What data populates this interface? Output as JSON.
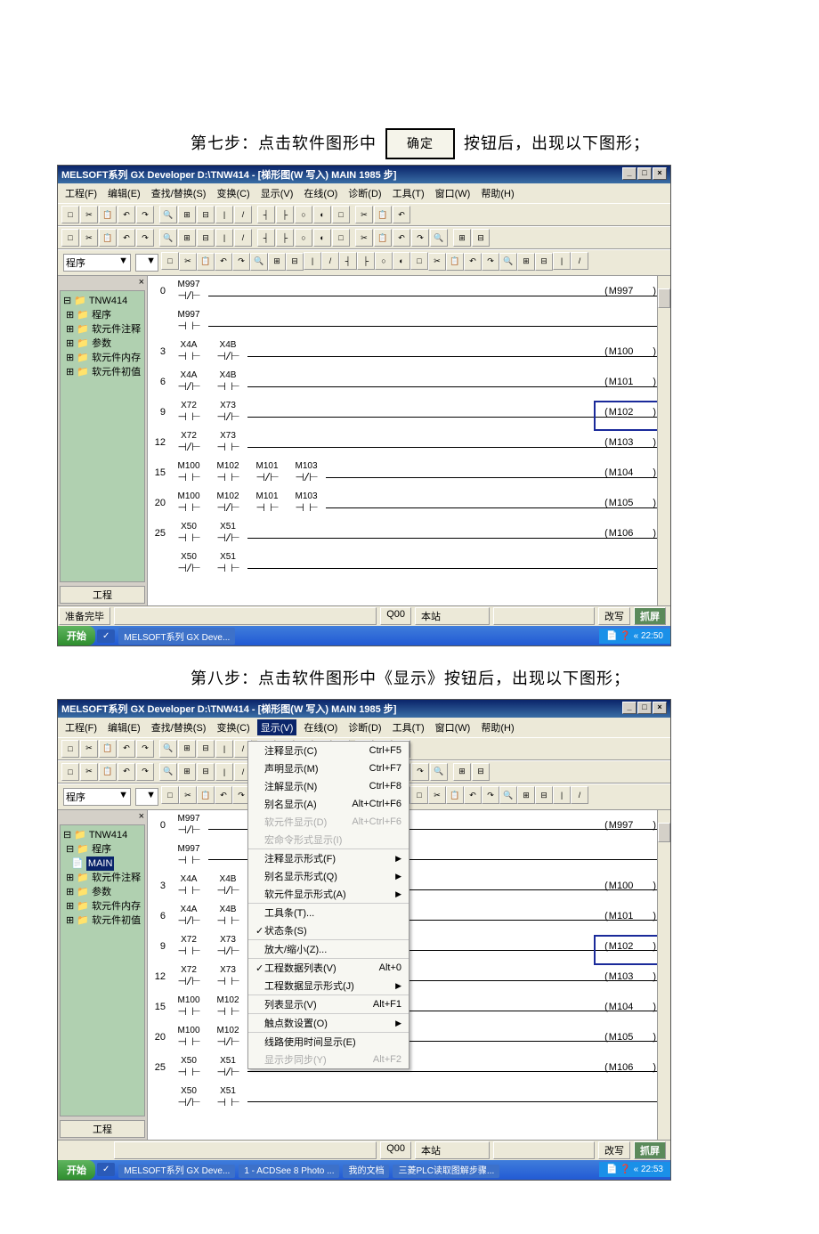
{
  "step7": {
    "pre": "第七步：点击软件图形中",
    "btn": "确定",
    "post": "按钮后，出现以下图形；"
  },
  "step8": "第八步：点击软件图形中《显示》按钮后，出现以下图形；",
  "title": "MELSOFT系列 GX Developer D:\\TNW414 - [梯形图(W 写入)    MAIN    1985 步]",
  "menu": [
    "工程(F)",
    "编辑(E)",
    "查找/替换(S)",
    "变换(C)",
    "显示(V)",
    "在线(O)",
    "诊断(D)",
    "工具(T)",
    "窗口(W)",
    "帮助(H)"
  ],
  "combo": "程序",
  "tree": {
    "root": "TNW414",
    "items": [
      "程序",
      "软元件注释",
      "参数",
      "软元件内存",
      "软元件初值"
    ],
    "main": "MAIN"
  },
  "tab": "工程",
  "ladder": [
    {
      "n": 0,
      "c": [
        {
          "l": "M997",
          "t": "nc"
        }
      ],
      "o": "M997"
    },
    {
      "n": null,
      "c": [
        {
          "l": "M997",
          "t": "no"
        }
      ],
      "o": null
    },
    {
      "n": 3,
      "c": [
        {
          "l": "X4A",
          "t": "no"
        },
        {
          "l": "X4B",
          "t": "nc"
        }
      ],
      "o": "M100"
    },
    {
      "n": 6,
      "c": [
        {
          "l": "X4A",
          "t": "nc"
        },
        {
          "l": "X4B",
          "t": "no"
        }
      ],
      "o": "M101"
    },
    {
      "n": 9,
      "c": [
        {
          "l": "X72",
          "t": "no"
        },
        {
          "l": "X73",
          "t": "nc"
        }
      ],
      "o": "M102",
      "hi": true
    },
    {
      "n": 12,
      "c": [
        {
          "l": "X72",
          "t": "nc"
        },
        {
          "l": "X73",
          "t": "no"
        }
      ],
      "o": "M103"
    },
    {
      "n": 15,
      "c": [
        {
          "l": "M100",
          "t": "no"
        },
        {
          "l": "M102",
          "t": "no"
        },
        {
          "l": "M101",
          "t": "nc"
        },
        {
          "l": "M103",
          "t": "nc"
        }
      ],
      "o": "M104"
    },
    {
      "n": 20,
      "c": [
        {
          "l": "M100",
          "t": "no"
        },
        {
          "l": "M102",
          "t": "nc"
        },
        {
          "l": "M101",
          "t": "no"
        },
        {
          "l": "M103",
          "t": "no"
        }
      ],
      "o": "M105"
    },
    {
      "n": 25,
      "c": [
        {
          "l": "X50",
          "t": "no"
        },
        {
          "l": "X51",
          "t": "nc"
        }
      ],
      "o": "M106"
    },
    {
      "n": null,
      "c": [
        {
          "l": "X50",
          "t": "nc"
        },
        {
          "l": "X51",
          "t": "no"
        }
      ],
      "o": null
    }
  ],
  "status": {
    "ready": "准备完毕",
    "cpu": "Q00",
    "host": "本站",
    "mode": "改写",
    "btn": "抓屏"
  },
  "taskbar": {
    "start": "开始",
    "app": "MELSOFT系列 GX Deve...",
    "t2_apps": [
      "MELSOFT系列 GX Deve...",
      "1 - ACDSee 8 Photo ...",
      "我的文档",
      "三菱PLC读取图解步骤..."
    ],
    "time1": "« 22:50",
    "time2": "« 22:53"
  },
  "dropdown": [
    {
      "l": "注释显示(C)",
      "s": "Ctrl+F5"
    },
    {
      "l": "声明显示(M)",
      "s": "Ctrl+F7"
    },
    {
      "l": "注解显示(N)",
      "s": "Ctrl+F8"
    },
    {
      "l": "别名显示(A)",
      "s": "Alt+Ctrl+F6"
    },
    {
      "l": "软元件显示(D)",
      "s": "Alt+Ctrl+F6",
      "dis": true
    },
    {
      "l": "宏命令形式显示(I)",
      "dis": true,
      "sep": true
    },
    {
      "l": "注释显示形式(F)",
      "sub": true
    },
    {
      "l": "别名显示形式(Q)",
      "sub": true
    },
    {
      "l": "软元件显示形式(A)",
      "sub": true,
      "sep": true
    },
    {
      "l": "工具条(T)..."
    },
    {
      "l": "状态条(S)",
      "chk": true,
      "sep": true
    },
    {
      "l": "放大/缩小(Z)...",
      "sep": true
    },
    {
      "l": "工程数据列表(V)",
      "s": "Alt+0",
      "chk": true
    },
    {
      "l": "工程数据显示形式(J)",
      "sub": true,
      "sep": true
    },
    {
      "l": "列表显示(V)",
      "s": "Alt+F1",
      "sep": true
    },
    {
      "l": "触点数设置(O)",
      "sub": true,
      "sep": true
    },
    {
      "l": "线路使用时间显示(E)"
    },
    {
      "l": "显示步同步(Y)",
      "s": "Alt+F2",
      "dis": true
    }
  ]
}
